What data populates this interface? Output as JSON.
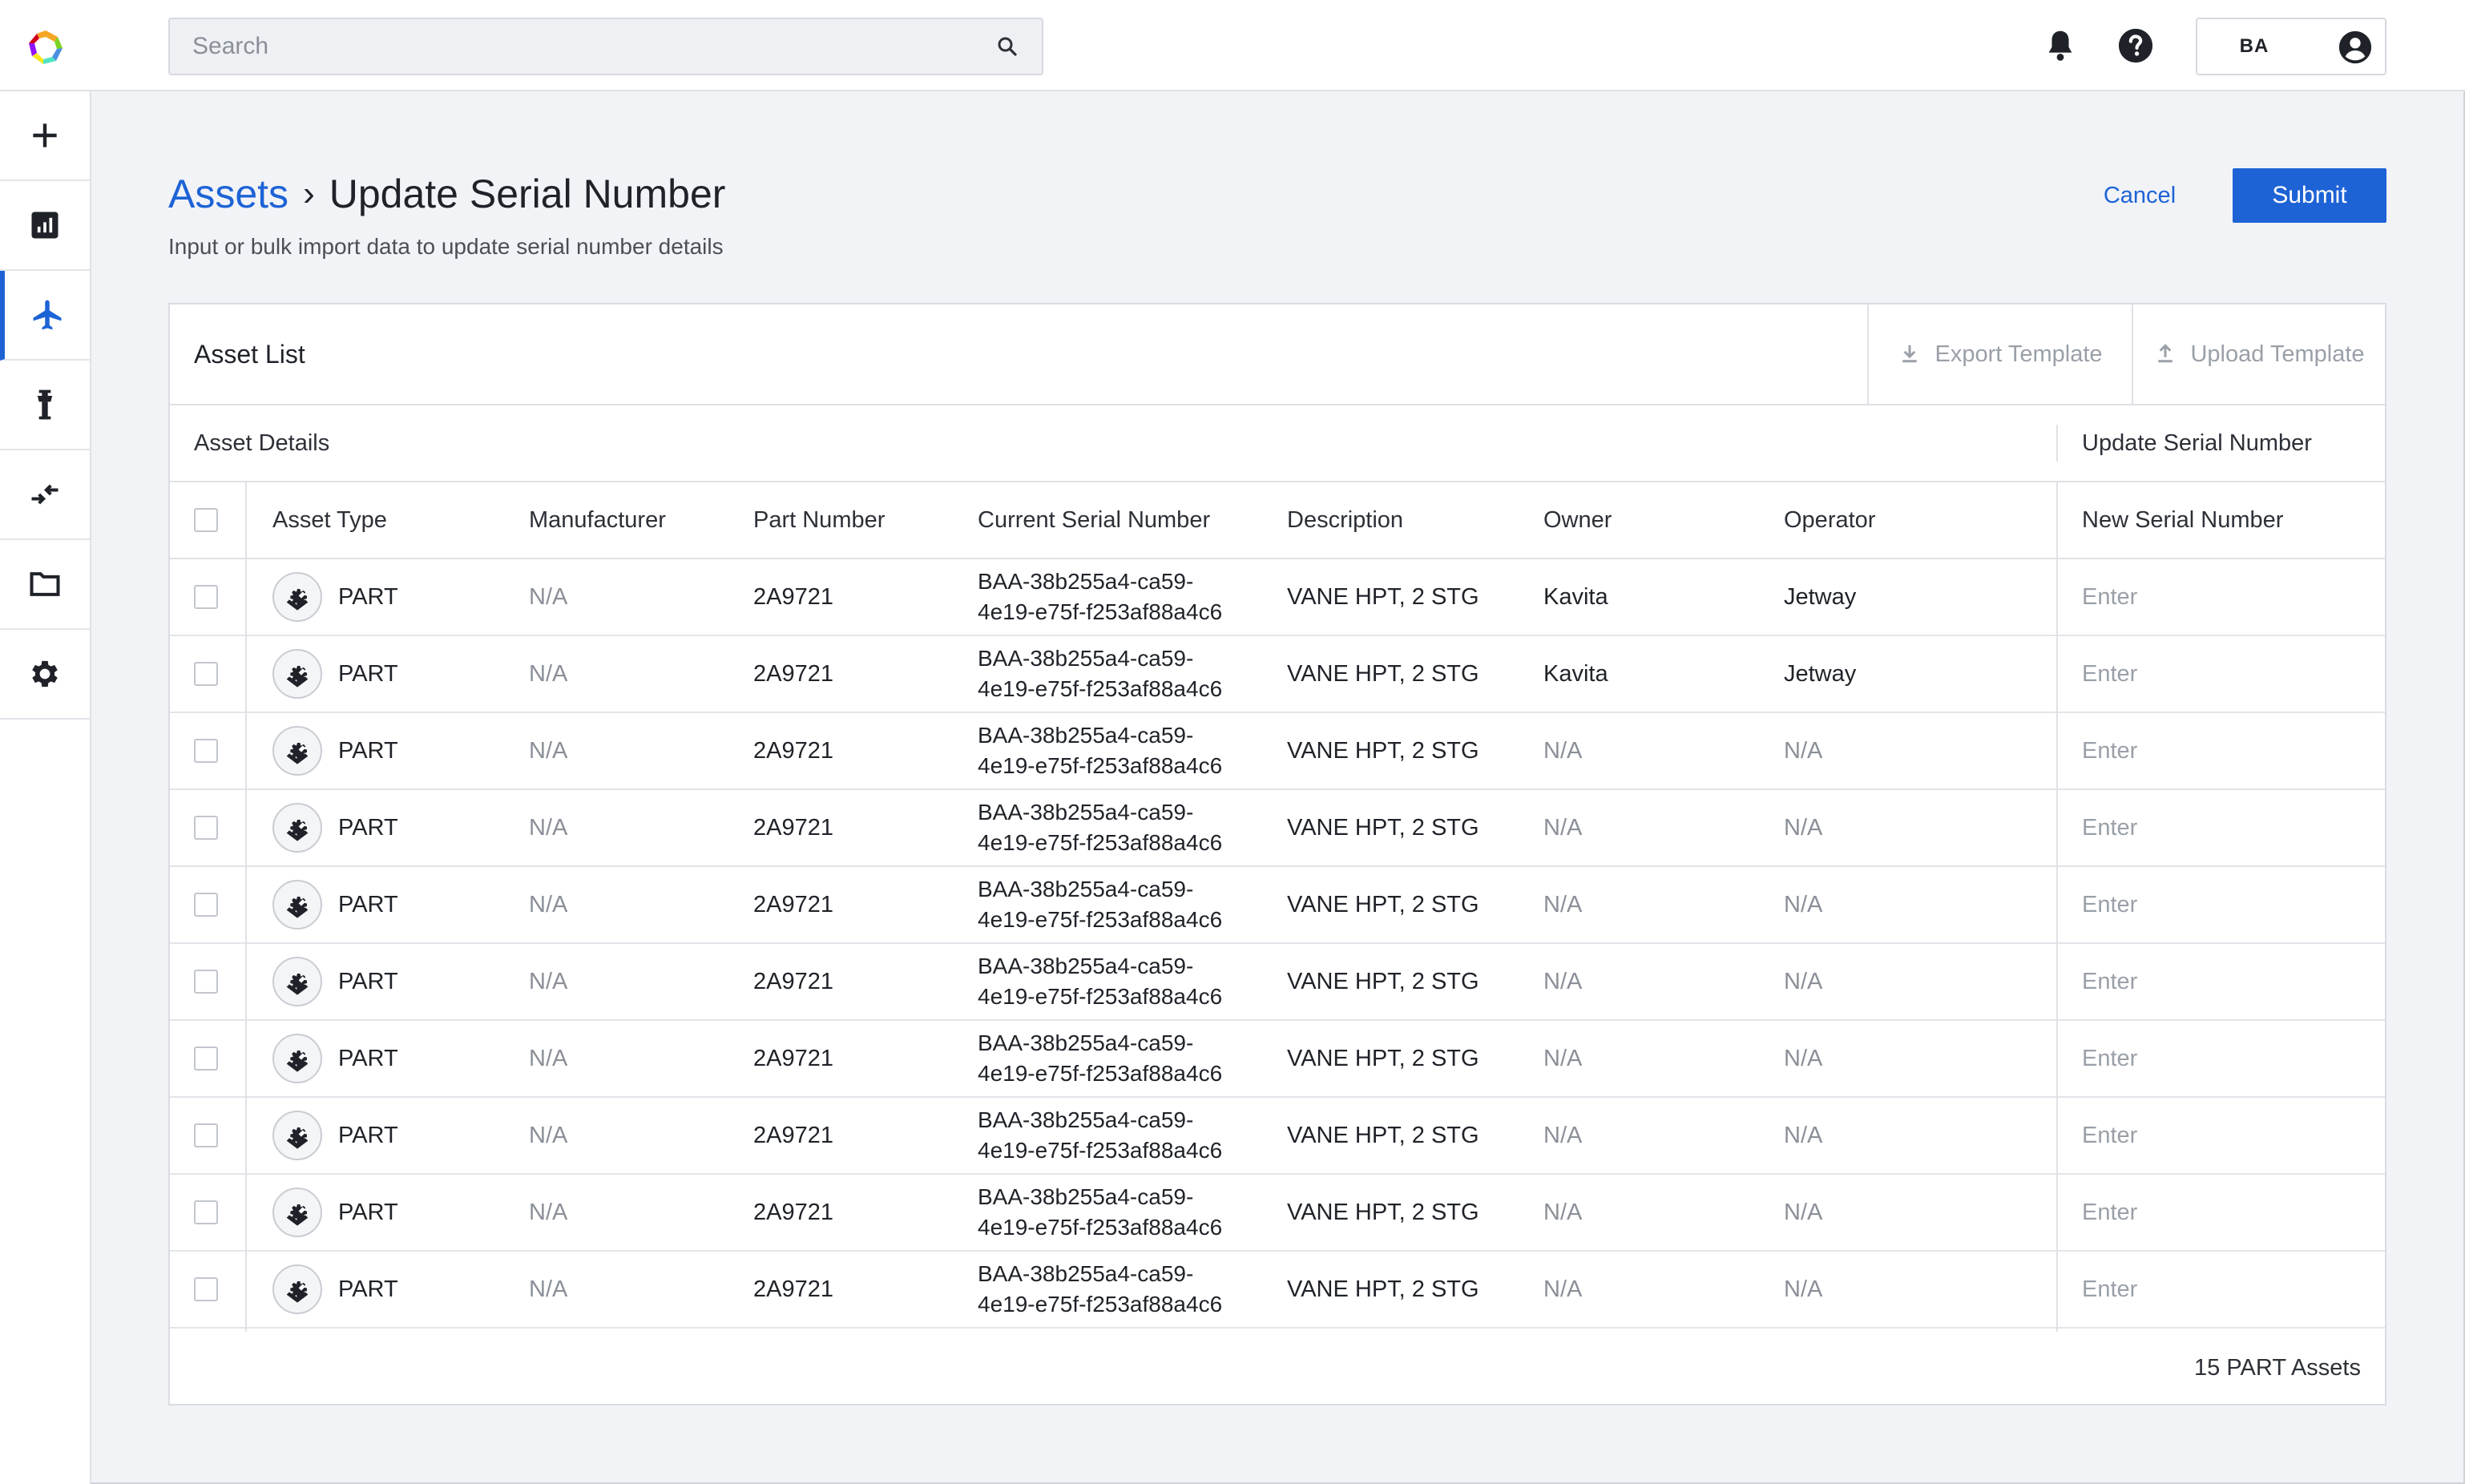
{
  "header": {
    "search_placeholder": "Search",
    "user_initials": "BA"
  },
  "sidebar": {
    "items": [
      {
        "icon": "plus-icon",
        "active": false
      },
      {
        "icon": "chart-icon",
        "active": false
      },
      {
        "icon": "airplane-icon",
        "active": true
      },
      {
        "icon": "tower-icon",
        "active": false
      },
      {
        "icon": "transfer-icon",
        "active": false
      },
      {
        "icon": "folder-icon",
        "active": false
      },
      {
        "icon": "gear-icon",
        "active": false
      }
    ]
  },
  "page": {
    "breadcrumb_root": "Assets",
    "breadcrumb_sep": "›",
    "title": "Update Serial Number",
    "subtitle": "Input or bulk import data to update serial number details",
    "cancel_label": "Cancel",
    "submit_label": "Submit"
  },
  "card": {
    "title": "Asset List",
    "export_label": "Export Template",
    "upload_label": "Upload Template",
    "group_left": "Asset Details",
    "group_right": "Update Serial Number",
    "columns": {
      "asset_type": "Asset Type",
      "manufacturer": "Manufacturer",
      "part_number": "Part Number",
      "current_serial": "Current Serial Number",
      "description": "Description",
      "owner": "Owner",
      "operator": "Operator",
      "new_serial": "New Serial Number"
    },
    "new_serial_placeholder": "Enter",
    "rows": [
      {
        "type": "PART",
        "manufacturer": "N/A",
        "part_number": "2A9721",
        "serial": "BAA-38b255a4-ca59-4e19-e75f-f253af88a4c6",
        "description": "VANE HPT, 2 STG",
        "owner": "Kavita",
        "operator": "Jetway"
      },
      {
        "type": "PART",
        "manufacturer": "N/A",
        "part_number": "2A9721",
        "serial": "BAA-38b255a4-ca59-4e19-e75f-f253af88a4c6",
        "description": "VANE HPT, 2 STG",
        "owner": "Kavita",
        "operator": "Jetway"
      },
      {
        "type": "PART",
        "manufacturer": "N/A",
        "part_number": "2A9721",
        "serial": "BAA-38b255a4-ca59-4e19-e75f-f253af88a4c6",
        "description": "VANE HPT, 2 STG",
        "owner": "N/A",
        "operator": "N/A"
      },
      {
        "type": "PART",
        "manufacturer": "N/A",
        "part_number": "2A9721",
        "serial": "BAA-38b255a4-ca59-4e19-e75f-f253af88a4c6",
        "description": "VANE HPT, 2 STG",
        "owner": "N/A",
        "operator": "N/A"
      },
      {
        "type": "PART",
        "manufacturer": "N/A",
        "part_number": "2A9721",
        "serial": "BAA-38b255a4-ca59-4e19-e75f-f253af88a4c6",
        "description": "VANE HPT, 2 STG",
        "owner": "N/A",
        "operator": "N/A"
      },
      {
        "type": "PART",
        "manufacturer": "N/A",
        "part_number": "2A9721",
        "serial": "BAA-38b255a4-ca59-4e19-e75f-f253af88a4c6",
        "description": "VANE HPT, 2 STG",
        "owner": "N/A",
        "operator": "N/A"
      },
      {
        "type": "PART",
        "manufacturer": "N/A",
        "part_number": "2A9721",
        "serial": "BAA-38b255a4-ca59-4e19-e75f-f253af88a4c6",
        "description": "VANE HPT, 2 STG",
        "owner": "N/A",
        "operator": "N/A"
      },
      {
        "type": "PART",
        "manufacturer": "N/A",
        "part_number": "2A9721",
        "serial": "BAA-38b255a4-ca59-4e19-e75f-f253af88a4c6",
        "description": "VANE HPT, 2 STG",
        "owner": "N/A",
        "operator": "N/A"
      },
      {
        "type": "PART",
        "manufacturer": "N/A",
        "part_number": "2A9721",
        "serial": "BAA-38b255a4-ca59-4e19-e75f-f253af88a4c6",
        "description": "VANE HPT, 2 STG",
        "owner": "N/A",
        "operator": "N/A"
      },
      {
        "type": "PART",
        "manufacturer": "N/A",
        "part_number": "2A9721",
        "serial": "BAA-38b255a4-ca59-4e19-e75f-f253af88a4c6",
        "description": "VANE HPT, 2 STG",
        "owner": "N/A",
        "operator": "N/A"
      }
    ],
    "footer_count": "15 PART Assets"
  },
  "colors": {
    "accent": "#1d63d6",
    "background": "#f2f3f7",
    "muted_text": "#8a8f98"
  }
}
